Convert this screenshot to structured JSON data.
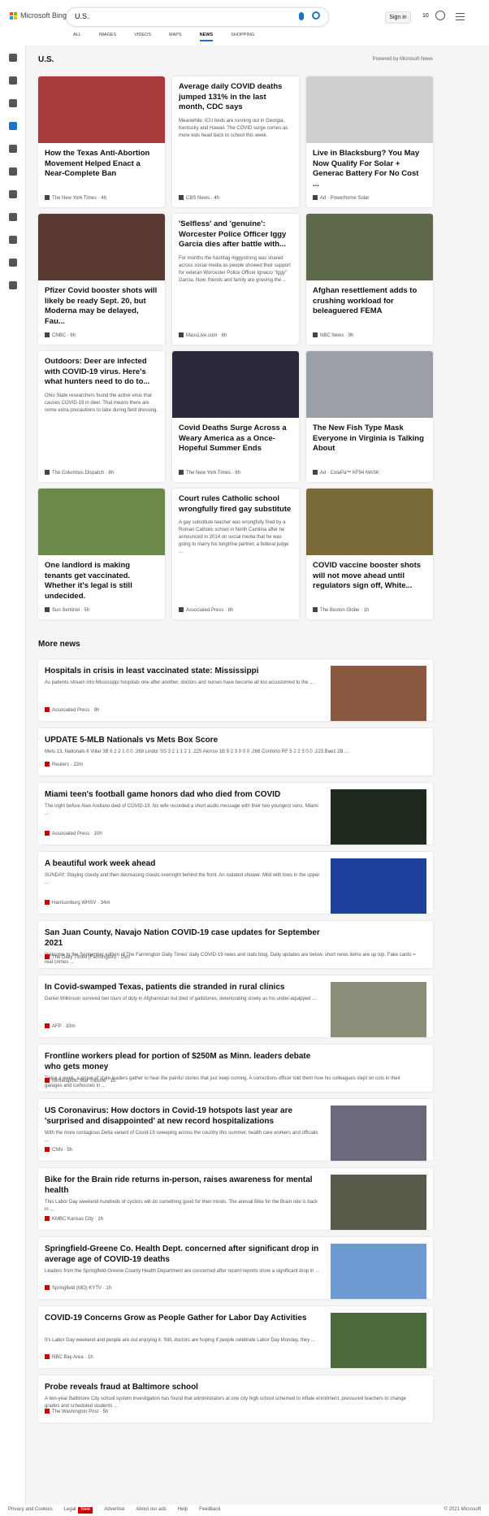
{
  "header": {
    "brand": "Microsoft Bing",
    "query": "U.S.",
    "sign_in": "Sign in",
    "rewards": "10"
  },
  "tabs": [
    "ALL",
    "IMAGES",
    "VIDEOS",
    "MAPS",
    "NEWS",
    "SHOPPING"
  ],
  "section": {
    "title": "U.S.",
    "powered": "Powered by Microsoft News"
  },
  "cards": [
    {
      "title": "How the Texas Anti-Abortion Movement Helped Enact a Near-Complete Ban",
      "summary": "",
      "source": "The New York Times · 4h",
      "img": "#a83a3a"
    },
    {
      "title": "Average daily COVID deaths jumped 131% in the last month, CDC says",
      "summary": "Meanwhile, ICU beds are running out in Georgia, Kentucky and Hawaii. The COVID surge comes as more kids head back to school this week.",
      "source": "CBS News · 4h",
      "img": ""
    },
    {
      "title": "Live in Blacksburg? You May Now Qualify For Solar + Generac Battery For No Cost ...",
      "summary": "",
      "source": "Ad · Powerhome Solar",
      "img": "#cfcfcf"
    },
    {
      "title": "Pfizer Covid booster shots will likely be ready Sept. 20, but Moderna may be delayed, Fau...",
      "summary": "",
      "source": "CNBC · 6h",
      "img": "#5a3a30"
    },
    {
      "title": "'Selfless' and 'genuine': Worcester Police Officer Iggy Garcia dies after battle with...",
      "summary": "For months the hashtag #iggystrong was shared across social media as people showed their support for veteran Worcester Police Officer Ignacio \"Iggy\" Garcia. Now, friends and family are grieving the ...",
      "source": "MassLive.com · 6h",
      "img": ""
    },
    {
      "title": "Afghan resettlement adds to crushing workload for beleaguered FEMA",
      "summary": "",
      "source": "NBC News · 9h",
      "img": "#5e6a4a"
    },
    {
      "title": "Outdoors: Deer are infected with COVID-19 virus. Here's what hunters need to do to...",
      "summary": "Ohio State researchers found the active virus that causes COVID-19 in deer. That means there are some extra precautions to take during field dressing.",
      "source": "The Columbus Dispatch · 8h",
      "img": ""
    },
    {
      "title": "Covid Deaths Surge Across a Weary America as a Once-Hopeful Summer Ends",
      "summary": "",
      "source": "The New York Times · 6h",
      "img": "#2a2a3a"
    },
    {
      "title": "The New Fish Type Mask Everyone in Virginia is Talking About",
      "summary": "",
      "source": "Ad · ColaPa™ KF94 MASK",
      "img": "#9aa0a6"
    },
    {
      "title": "One landlord is making tenants get vaccinated. Whether it's legal is still undecided.",
      "summary": "",
      "source": "Sun Sentinel · 5h",
      "img": "#6b8a4a"
    },
    {
      "title": "Court rules Catholic school wrongfully fired gay substitute",
      "summary": "A gay substitute teacher was wrongfully fired by a Roman Catholic school in North Carolina after he announced in 2014 on social media that he was going to marry his longtime partner, a federal judge ...",
      "source": "Associated Press · 8h",
      "img": ""
    },
    {
      "title": "COVID vaccine booster shots will not move ahead until regulators sign off, White...",
      "summary": "",
      "source": "The Boston Globe · 1h",
      "img": "#7a6a3a"
    }
  ],
  "more": {
    "title": "More news",
    "items": [
      {
        "title": "Hospitals in crisis in least vaccinated state: Mississippi",
        "summary": "As patients stream into Mississippi hospitals one after another, doctors and nurses have become all too accustomed to the ...",
        "source": "Associated Press · 9h",
        "img": "#8a5a40"
      },
      {
        "title": "UPDATE 5-MLB Nationals vs Mets Box Score",
        "summary": "Mets 13, Nationals 6 Villar 3B 6 2 2 1 0 0 .268 Lindor SS 3 2 1 1 2 1 .225 Alonso 1B 5 2 3 0 0 0 .266 Conforto RF 5 2 2 3 0 0 .223 Baez 2B ...",
        "source": "Reuters · 22m",
        "img": ""
      },
      {
        "title": "Miami teen's football game honors dad who died from COVID",
        "summary": "The night before Alan Arellano died of COVID-19, his wife recorded a short audio message with their two youngest sons. Miami ...",
        "source": "Associated Press · 10h",
        "img": "#1f2a1f"
      },
      {
        "title": "A beautiful work week ahead",
        "summary": "SUNDAY: Staying cloudy and then decreasing clouds overnight behind the front. An isolated shower. Mild with lows in the upper ...",
        "source": "Harrisonburg WHSV · 34m",
        "img": "#1e3f9a"
      },
      {
        "title": "San Juan County, Navajo Nation COVID-19 case updates for September 2021",
        "summary": "Welcome to the September edition of The Farmington Daily Times' daily COVID-19 news and stats blog. Daily updates are below, short news items are up top. Fake cards = real crimes ...",
        "source": "The Daily Times (Farmington) · 15m",
        "img": ""
      },
      {
        "title": "In Covid-swamped Texas, patients die stranded in rural clinics",
        "summary": "Daniel Wilkinson survived two tours of duty in Afghanistan but died of gallstones, deteriorating slowly as his under-equipped ...",
        "source": "AFP · 33m",
        "img": "#8a8f7a"
      },
      {
        "title": "Frontline workers plead for portion of $250M as Minn. leaders debate who gets money",
        "summary": "Twice a week, a group of state leaders gather to hear the painful stories that just keep coming. A corrections officer told them how his colleagues slept on cots in their garages and icehouses in ...",
        "source": "Minneapolis Star Tribune · 1h",
        "img": ""
      },
      {
        "title": "US Coronavirus: How doctors in Covid-19 hotspots last year are 'surprised and disappointed' at new record hospitalizations",
        "summary": "With the more contagious Delta variant of Covid-19 sweeping across the country this summer, health care workers and officials ...",
        "source": "CNN · 5h",
        "img": "#6a6a7a"
      },
      {
        "title": "Bike for the Brain ride returns in-person, raises awareness for mental health",
        "summary": "This Labor Day weekend hundreds of cyclists will do something good for their minds. The annual Bike for the Brain ride is back in ...",
        "source": "KMBC Kansas City · 1h",
        "img": "#5a5a4a"
      },
      {
        "title": "Springfield-Greene Co. Health Dept. concerned after significant drop in average age of COVID-19 deaths",
        "summary": "Leaders from the Springfield-Greene County Health Department are concerned after recent reports show a significant drop in ...",
        "source": "Springfield (MO) KYTV · 1h",
        "img": "#6d9ad0"
      },
      {
        "title": "COVID-19 Concerns Grow as People Gather for Labor Day Activities",
        "summary": "It's Labor Day weekend and people are out enjoying it. Still, doctors are hoping if people celebrate Labor Day Monday, they ...",
        "source": "NBC Bay Area · 1h",
        "img": "#4a6a3a"
      },
      {
        "title": "Probe reveals fraud at Baltimore school",
        "summary": "A two-year Baltimore City school system investigation has found that administrators at one city high school schemed to inflate enrollment, pressured teachers to change grades and scheduled students ...",
        "source": "The Washington Post · 5h",
        "img": ""
      }
    ]
  },
  "footer": {
    "links": [
      "Privacy and Cookies",
      "Legal",
      "Advertise",
      "About our ads",
      "Help",
      "Feedback"
    ],
    "new_badge": "New",
    "copyright": "© 2021 Microsoft"
  }
}
